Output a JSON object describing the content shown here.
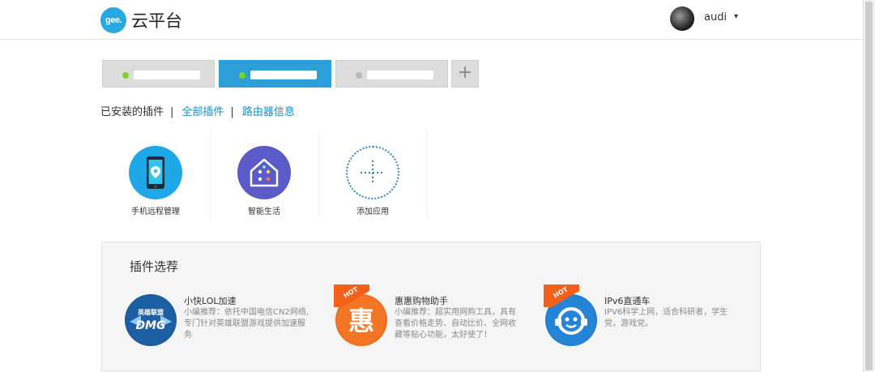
{
  "header": {
    "logo_badge": "gee.",
    "logo_text": "云平台",
    "username": "audi",
    "caret": "▾"
  },
  "routers": {
    "tabs": [
      {
        "status": "online",
        "active": false
      },
      {
        "status": "online",
        "active": true
      },
      {
        "status": "offline",
        "active": false
      }
    ],
    "add_label": "+"
  },
  "plugin_nav": {
    "installed": "已安装的插件",
    "separator": "|",
    "all_plugins": "全部插件",
    "router_info": "路由器信息"
  },
  "apps": [
    {
      "label": "手机远程管理",
      "icon": "phone-remote-icon"
    },
    {
      "label": "智能生活",
      "icon": "smart-home-icon"
    },
    {
      "label": "添加应用",
      "icon": "add-app-icon"
    }
  ],
  "recommend": {
    "title": "插件选荐",
    "items": [
      {
        "name": "小快LOL加速",
        "desc": "小编推荐：依托中国电信CN2网络,专门针对英雄联盟游戏提供加速服务",
        "hot": false,
        "icon": "lol-accelerator-icon",
        "icon_text": "英雄联盟",
        "icon_sub": "DMG"
      },
      {
        "name": "惠惠购物助手",
        "desc": "小编推荐：超实用网购工具，具有查看价格走势、自动比价、全网收藏等贴心功能，太好使了！",
        "hot": true,
        "hot_label": "HOT",
        "icon": "huihui-shopping-icon",
        "icon_text": "惠"
      },
      {
        "name": "IPv6直通车",
        "desc": "IPV6科学上网，适合科研者，学生党，游戏党。",
        "hot": true,
        "hot_label": "HOT",
        "icon": "ipv6-icon"
      }
    ]
  },
  "colors": {
    "accent": "#2c9fd9",
    "link": "#1a8ccc",
    "online": "#7ed321",
    "hot": "#f26b1d"
  }
}
